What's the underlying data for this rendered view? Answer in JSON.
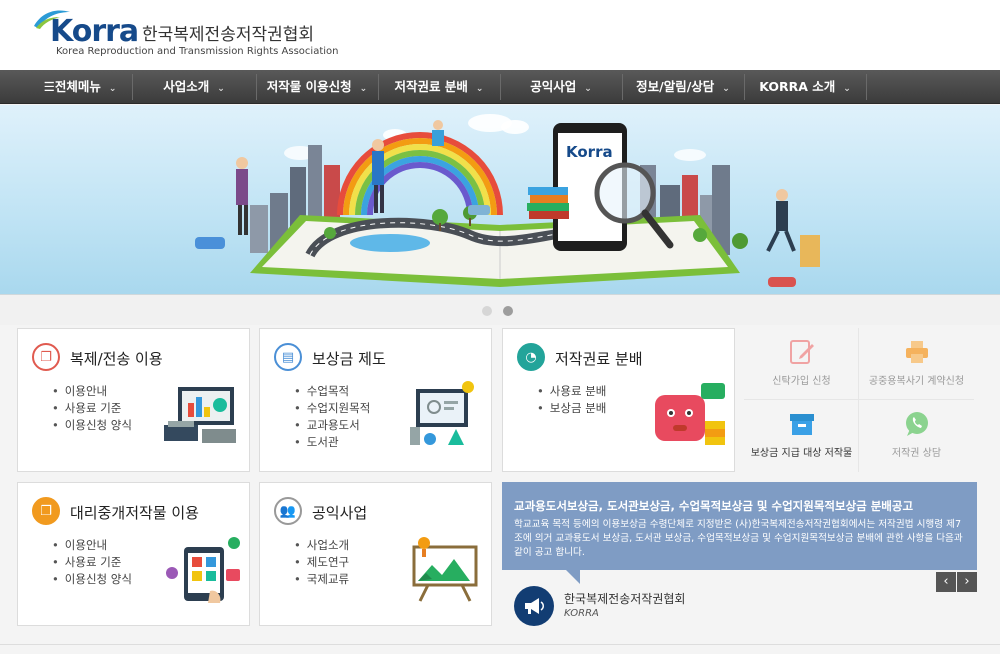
{
  "header": {
    "brand": "Korra",
    "name_ko": "한국복제전송저작권협회",
    "name_en": "Korea Reproduction and Transmission Rights Association"
  },
  "nav": {
    "items": [
      {
        "label": "☰전체메뉴"
      },
      {
        "label": "사업소개"
      },
      {
        "label": "저작물 이용신청"
      },
      {
        "label": "저작권료 분배"
      },
      {
        "label": "공익사업"
      },
      {
        "label": "정보/알림/상담"
      },
      {
        "label": "KORRA 소개"
      }
    ]
  },
  "hero": {
    "phone_brand": "Korra"
  },
  "cards": [
    {
      "title": "복제/전송 이용",
      "items": [
        "이용안내",
        "사용료 기준",
        "이용신청 양식"
      ]
    },
    {
      "title": "보상금 제도",
      "items": [
        "수업목적",
        "수업지원목적",
        "교과용도서",
        "도서관"
      ]
    },
    {
      "title": "저작권료 분배",
      "items": [
        "사용료 분배",
        "보상금 분배"
      ]
    },
    {
      "title": "대리중개저작물 이용",
      "items": [
        "이용안내",
        "사용료 기준",
        "이용신청 양식"
      ]
    },
    {
      "title": "공익사업",
      "items": [
        "사업소개",
        "제도연구",
        "국제교류"
      ]
    }
  ],
  "quick_links": [
    {
      "label": "신탁가입 신청"
    },
    {
      "label": "공중용복사기 계약신청"
    },
    {
      "label": "보상금 지급 대상 저작물"
    },
    {
      "label": "저작권 상담"
    }
  ],
  "notice": {
    "title": "교과용도서보상금, 도서관보상금, 수업목적보상금 및 수업지원목적보상금 분배공고",
    "body": "학교교육 목적 등에의 이용보상금 수령단체로 지정받은 (사)한국복제전송저작권협회에서는 저작권법 시행령 제7조에 의거 교과용도서 보상금, 도서관 보상금, 수업목적보상금 및 수업지원목적보상금 분배에 관한 사항을 다음과 같이 공고 합니다.",
    "org": "한국복제전송저작권협회",
    "org_sub": "KORRA",
    "prev": "‹",
    "next": "›"
  },
  "colors": {
    "nav_bg": "#454545",
    "card1_icon": "#e05a4f",
    "card2_icon": "#4a8fd6",
    "card3_icon": "#23a49a",
    "card4_icon": "#f19a1f",
    "card5_icon": "#888888",
    "notice_bg": "#7f9cc4",
    "brand": "#164a8a"
  }
}
